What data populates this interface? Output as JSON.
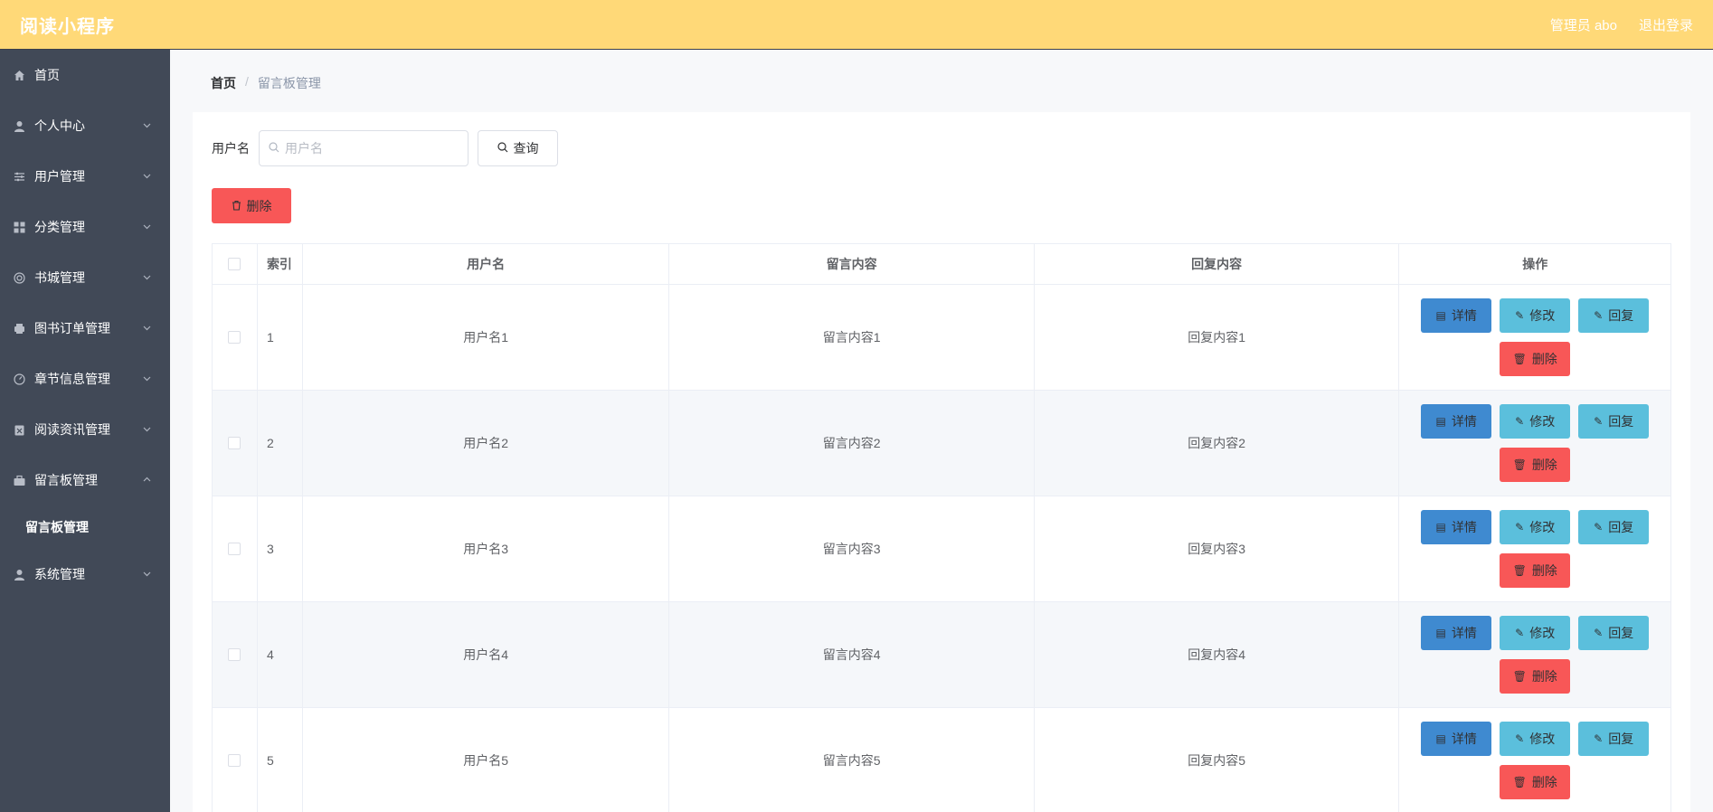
{
  "header": {
    "title": "阅读小程序",
    "admin_label": "管理员 abo",
    "logout_label": "退出登录"
  },
  "sidebar": {
    "items": [
      {
        "label": "首页",
        "icon": "home-icon",
        "expandable": false
      },
      {
        "label": "个人中心",
        "icon": "user-icon",
        "expandable": true
      },
      {
        "label": "用户管理",
        "icon": "sliders-icon",
        "expandable": true
      },
      {
        "label": "分类管理",
        "icon": "grid-icon",
        "expandable": true
      },
      {
        "label": "书城管理",
        "icon": "lifebuoy-icon",
        "expandable": true
      },
      {
        "label": "图书订单管理",
        "icon": "printer-icon",
        "expandable": true
      },
      {
        "label": "章节信息管理",
        "icon": "gauge-icon",
        "expandable": true
      },
      {
        "label": "阅读资讯管理",
        "icon": "clipboard-icon",
        "expandable": true
      },
      {
        "label": "留言板管理",
        "icon": "briefcase-icon",
        "expandable": true,
        "expanded": true
      },
      {
        "label": "系统管理",
        "icon": "user-icon",
        "expandable": true
      }
    ],
    "submenu": {
      "label": "留言板管理"
    }
  },
  "breadcrumb": {
    "home": "首页",
    "separator": "/",
    "current": "留言板管理"
  },
  "search": {
    "label": "用户名",
    "placeholder": "用户名",
    "value": "",
    "query_label": "查询"
  },
  "toolbar": {
    "delete_label": "删除"
  },
  "table": {
    "columns": {
      "index": "索引",
      "username": "用户名",
      "message": "留言内容",
      "reply": "回复内容",
      "actions": "操作"
    },
    "rows": [
      {
        "index": "1",
        "username": "用户名1",
        "message": "留言内容1",
        "reply": "回复内容1"
      },
      {
        "index": "2",
        "username": "用户名2",
        "message": "留言内容2",
        "reply": "回复内容2"
      },
      {
        "index": "3",
        "username": "用户名3",
        "message": "留言内容3",
        "reply": "回复内容3"
      },
      {
        "index": "4",
        "username": "用户名4",
        "message": "留言内容4",
        "reply": "回复内容4"
      },
      {
        "index": "5",
        "username": "用户名5",
        "message": "留言内容5",
        "reply": "回复内容5"
      }
    ],
    "actions": {
      "detail": "详情",
      "edit": "修改",
      "reply": "回复",
      "delete": "删除"
    }
  },
  "colors": {
    "header_bg": "#ffd978",
    "sidebar_bg": "#414957",
    "detail_btn": "#3f8ad0",
    "edit_btn": "#5bbfdc",
    "delete_btn": "#f85757"
  }
}
